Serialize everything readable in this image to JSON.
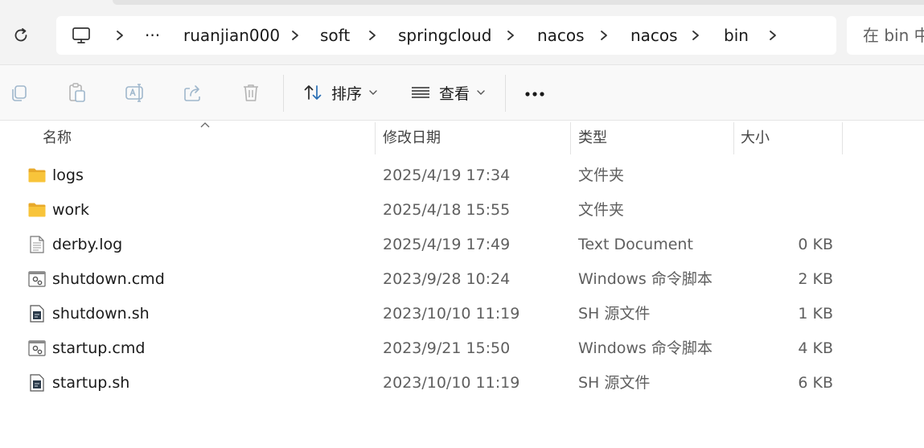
{
  "breadcrumb": {
    "items": [
      "ruanjian000",
      "soft",
      "springcloud",
      "nacos",
      "nacos",
      "bin"
    ],
    "ellipsis": "···"
  },
  "search": {
    "placeholder": "在 bin 中"
  },
  "toolbar": {
    "sort_label": "排序",
    "view_label": "查看",
    "more_label": "•••"
  },
  "columns": {
    "name": "名称",
    "modified": "修改日期",
    "type": "类型",
    "size": "大小"
  },
  "files": [
    {
      "name": "logs",
      "modified": "2025/4/19 17:34",
      "type": "文件夹",
      "size": "",
      "icon": "folder-icon"
    },
    {
      "name": "work",
      "modified": "2025/4/18 15:55",
      "type": "文件夹",
      "size": "",
      "icon": "folder-icon"
    },
    {
      "name": "derby.log",
      "modified": "2025/4/19 17:49",
      "type": "Text Document",
      "size": "0 KB",
      "icon": "text-file-icon"
    },
    {
      "name": "shutdown.cmd",
      "modified": "2023/9/28 10:24",
      "type": "Windows 命令脚本",
      "size": "2 KB",
      "icon": "cmd-script-icon"
    },
    {
      "name": "shutdown.sh",
      "modified": "2023/10/10 11:19",
      "type": "SH 源文件",
      "size": "1 KB",
      "icon": "sh-file-icon"
    },
    {
      "name": "startup.cmd",
      "modified": "2023/9/21 15:50",
      "type": "Windows 命令脚本",
      "size": "4 KB",
      "icon": "cmd-script-icon"
    },
    {
      "name": "startup.sh",
      "modified": "2023/10/10 11:19",
      "type": "SH 源文件",
      "size": "6 KB",
      "icon": "sh-file-icon"
    }
  ],
  "colors": {
    "folder": "#f8c43a",
    "toolbar_bg": "#f9f9f9",
    "topbar_bg": "#f3f3f3",
    "icon_disabled": "#9fb7cc"
  }
}
